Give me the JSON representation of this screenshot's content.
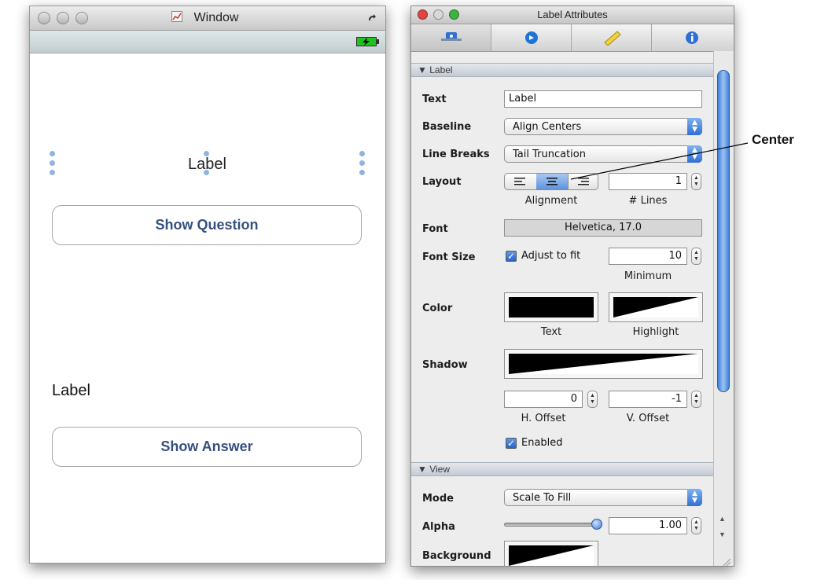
{
  "window": {
    "title": "Window",
    "label_top": "Label",
    "button_question": "Show Question",
    "label_bottom": "Label",
    "button_answer": "Show Answer"
  },
  "inspector": {
    "title": "Label Attributes",
    "tabs": [
      "attributes-icon",
      "connections-icon",
      "size-ruler-icon",
      "identity-info-icon"
    ],
    "label_section": "Label",
    "text_label": "Text",
    "text_value": "Label",
    "baseline_label": "Baseline",
    "baseline_value": "Align Centers",
    "linebreaks_label": "Line Breaks",
    "linebreaks_value": "Tail Truncation",
    "layout_label": "Layout",
    "lines_value": "1",
    "alignment_caption": "Alignment",
    "lines_caption": "# Lines",
    "font_label": "Font",
    "font_value": "Helvetica, 17.0",
    "fontsize_label": "Font Size",
    "adjust_label": "Adjust to fit",
    "adjust_checked": true,
    "minimum_value": "10",
    "minimum_caption": "Minimum",
    "color_label": "Color",
    "text_color_caption": "Text",
    "highlight_caption": "Highlight",
    "shadow_label": "Shadow",
    "h_offset_value": "0",
    "v_offset_value": "-1",
    "h_offset_caption": "H. Offset",
    "v_offset_caption": "V. Offset",
    "enabled_label": "Enabled",
    "enabled_checked": true,
    "view_section": "View",
    "mode_label": "Mode",
    "mode_value": "Scale To Fill",
    "alpha_label": "Alpha",
    "alpha_value": "1.00",
    "alpha_level": 1.0,
    "background_label": "Background"
  },
  "callout": "Center",
  "colors": {
    "button_text": "#35507f",
    "selection_handle": "#8fb4e0",
    "popup_accent": "#2f6fd2",
    "close_red": "#e0443e",
    "minimize_yellow": "#f0b429",
    "zoom_green": "#3fb23f"
  }
}
